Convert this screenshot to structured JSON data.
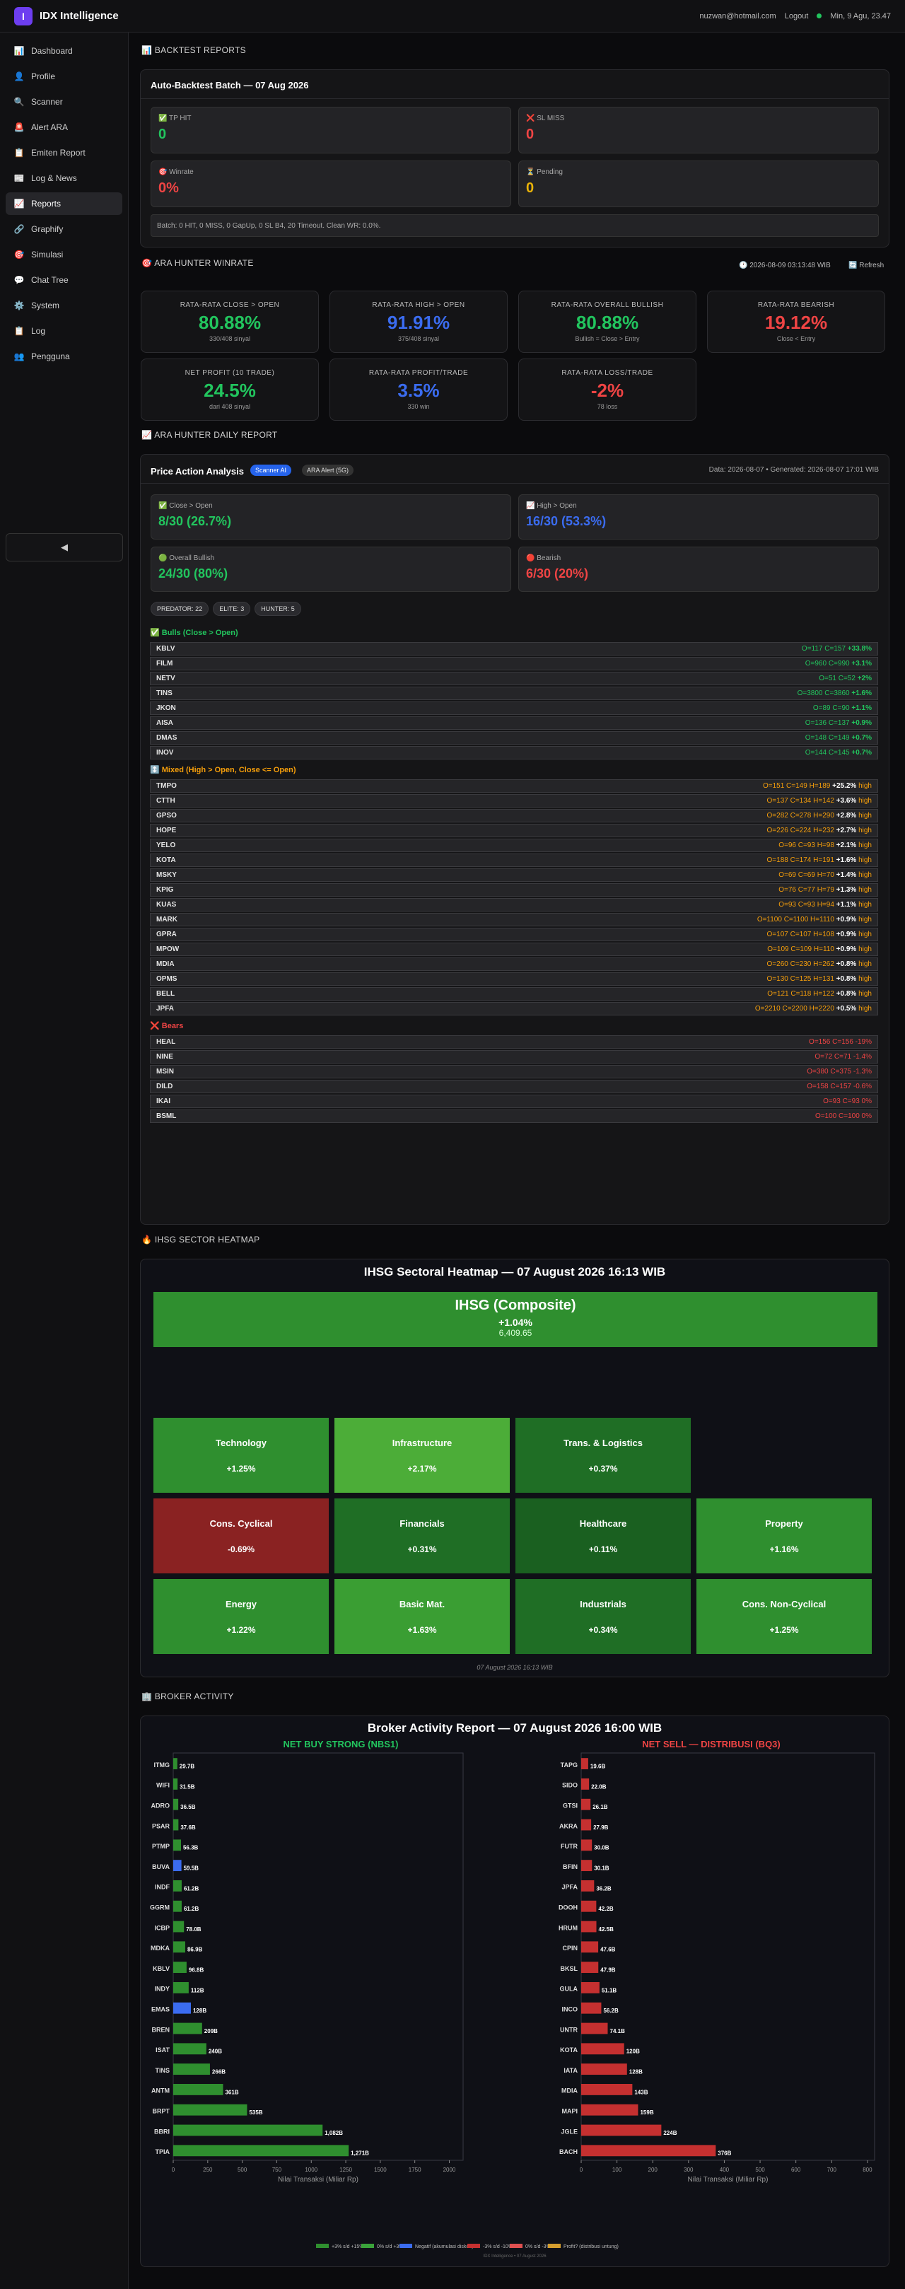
{
  "app": {
    "logo": "I",
    "name": "IDX Intelligence"
  },
  "topbar": {
    "email": "nuzwan@hotmail.com",
    "logout": "Logout",
    "datetime": "Min, 9 Agu, 23.47"
  },
  "sidebar": {
    "items": [
      {
        "icon": "📊",
        "label": "Dashboard"
      },
      {
        "icon": "👤",
        "label": "Profile"
      },
      {
        "icon": "🔍",
        "label": "Scanner"
      },
      {
        "icon": "🚨",
        "label": "Alert ARA"
      },
      {
        "icon": "📋",
        "label": "Emiten Report"
      },
      {
        "icon": "📰",
        "label": "Log & News"
      },
      {
        "icon": "📈",
        "label": "Reports"
      },
      {
        "icon": "🔗",
        "label": "Graphify"
      },
      {
        "icon": "🎯",
        "label": "Simulasi"
      },
      {
        "icon": "💬",
        "label": "Chat Tree"
      },
      {
        "icon": "⚙️",
        "label": "System"
      },
      {
        "icon": "📋",
        "label": "Log"
      },
      {
        "icon": "👥",
        "label": "Pengguna"
      }
    ],
    "collapse": "◀"
  },
  "backtest": {
    "section": "📊 BACKTEST REPORTS",
    "title": "Auto-Backtest Batch — 07 Aug 2026",
    "tp": {
      "label": "✅ TP HIT",
      "value": "0"
    },
    "sl": {
      "label": "❌ SL MISS",
      "value": "0"
    },
    "winrate": {
      "label": "🎯 Winrate",
      "value": "0%"
    },
    "pending": {
      "label": "⏳ Pending",
      "value": "0"
    },
    "note": "Batch: 0 HIT, 0 MISS, 0 GapUp, 0 SL B4, 20 Timeout. Clean WR: 0.0%."
  },
  "winrate": {
    "section": "🎯 ARA HUNTER WINRATE",
    "time": "🕐 2026-08-09 03:13:48 WIB",
    "refresh": "🔄 Refresh",
    "cards": [
      {
        "label": "RATA-RATA CLOSE > OPEN",
        "value": "80.88%",
        "sub": "330/408 sinyal",
        "color": "#22c55e"
      },
      {
        "label": "RATA-RATA HIGH > OPEN",
        "value": "91.91%",
        "sub": "375/408 sinyal",
        "color": "#3b6cf0"
      },
      {
        "label": "RATA-RATA OVERALL BULLISH",
        "value": "80.88%",
        "sub": "Bullish = Close > Entry",
        "color": "#22c55e"
      },
      {
        "label": "RATA-RATA BEARISH",
        "value": "19.12%",
        "sub": "Close < Entry",
        "color": "#ef4444"
      },
      {
        "label": "NET PROFIT (10 TRADE)",
        "value": "24.5%",
        "sub": "dari 408 sinyal",
        "color": "#22c55e"
      },
      {
        "label": "RATA-RATA PROFIT/TRADE",
        "value": "3.5%",
        "sub": "330 win",
        "color": "#3b6cf0"
      },
      {
        "label": "RATA-RATA LOSS/TRADE",
        "value": "-2%",
        "sub": "78 loss",
        "color": "#ef4444"
      }
    ]
  },
  "daily": {
    "section": "📈 ARA HUNTER DAILY REPORT",
    "title": "Price Action Analysis",
    "badge1": "Scanner AI",
    "badge2": "ARA Alert (5G)",
    "meta": "Data: 2026-08-07 • Generated: 2026-08-07 17:01 WIB",
    "s1": {
      "label": "✅ Close > Open",
      "value": "8/30 (26.7%)"
    },
    "s2": {
      "label": "📈 High > Open",
      "value": "16/30 (53.3%)"
    },
    "s3": {
      "label": "🟢 Overall Bullish",
      "value": "24/30 (80%)"
    },
    "s4": {
      "label": "🔴 Bearish",
      "value": "6/30 (20%)"
    },
    "tags": [
      "PREDATOR: 22",
      "ELITE: 3",
      "HUNTER: 5"
    ],
    "bulls_title": "✅ Bulls (Close > Open)",
    "bulls": [
      [
        "KBLV",
        "O=117 C=157 ",
        "+33.8%",
        ""
      ],
      [
        "FILM",
        "O=960 C=990 ",
        "+3.1%",
        ""
      ],
      [
        "NETV",
        "O=51 C=52 ",
        "+2%",
        ""
      ],
      [
        "TINS",
        "O=3800 C=3860 ",
        "+1.6%",
        ""
      ],
      [
        "JKON",
        "O=89 C=90 ",
        "+1.1%",
        ""
      ],
      [
        "AISA",
        "O=136 C=137 ",
        "+0.9%",
        ""
      ],
      [
        "DMAS",
        "O=148 C=149 ",
        "+0.7%",
        ""
      ],
      [
        "INOV",
        "O=144 C=145 ",
        "+0.7%",
        ""
      ]
    ],
    "mixed_title": "↕️ Mixed (High > Open, Close <= Open)",
    "mixed": [
      [
        "TMPO",
        "O=151 C=149 H=189 ",
        "+25.2%",
        " high"
      ],
      [
        "CTTH",
        "O=137 C=134 H=142 ",
        "+3.6%",
        " high"
      ],
      [
        "GPSO",
        "O=282 C=278 H=290 ",
        "+2.8%",
        " high"
      ],
      [
        "HOPE",
        "O=226 C=224 H=232 ",
        "+2.7%",
        " high"
      ],
      [
        "YELO",
        "O=96 C=93 H=98 ",
        "+2.1%",
        " high"
      ],
      [
        "KOTA",
        "O=188 C=174 H=191 ",
        "+1.6%",
        " high"
      ],
      [
        "MSKY",
        "O=69 C=69 H=70 ",
        "+1.4%",
        " high"
      ],
      [
        "KPIG",
        "O=76 C=77 H=79 ",
        "+1.3%",
        " high"
      ],
      [
        "KUAS",
        "O=93 C=93 H=94 ",
        "+1.1%",
        " high"
      ],
      [
        "MARK",
        "O=1100 C=1100 H=1110 ",
        "+0.9%",
        " high"
      ],
      [
        "GPRA",
        "O=107 C=107 H=108 ",
        "+0.9%",
        " high"
      ],
      [
        "MPOW",
        "O=109 C=109 H=110 ",
        "+0.9%",
        " high"
      ],
      [
        "MDIA",
        "O=260 C=230 H=262 ",
        "+0.8%",
        " high"
      ],
      [
        "OPMS",
        "O=130 C=125 H=131 ",
        "+0.8%",
        " high"
      ],
      [
        "BELL",
        "O=121 C=118 H=122 ",
        "+0.8%",
        " high"
      ],
      [
        "JPFA",
        "O=2210 C=2200 H=2220 ",
        "+0.5%",
        " high"
      ]
    ],
    "bears_title": "❌ Bears",
    "bears": [
      [
        "HEAL",
        "O=156 C=156 -19%",
        ""
      ],
      [
        "NINE",
        "O=72 C=71 -1.4%",
        ""
      ],
      [
        "MSIN",
        "O=380 C=375 -1.3%",
        ""
      ],
      [
        "DILD",
        "O=158 C=157 -0.6%",
        ""
      ],
      [
        "IKAI",
        "O=93 C=93 0%",
        ""
      ],
      [
        "BSML",
        "O=100 C=100 0%",
        ""
      ]
    ]
  },
  "heatmap": {
    "section": "🔥 IHSG SECTOR HEATMAP",
    "title": "IHSG Sectoral Heatmap — 07 August 2026 16:13 WIB",
    "ihsg": "IHSG (Composite)",
    "ihsg_chg": "+1.04%",
    "ihsg_val": "6,409.65",
    "footer": "07 August 2026 16:13 WIB",
    "sectors": [
      {
        "name": "Technology",
        "chg": "+1.25%",
        "color": "#2f8f2f"
      },
      {
        "name": "Infrastructure",
        "chg": "+2.17%",
        "color": "#4cad38"
      },
      {
        "name": "Trans. & Logistics",
        "chg": "+0.37%",
        "color": "#1f6e25"
      },
      {
        "name": "Cons. Cyclical",
        "chg": "-0.69%",
        "color": "#8a2222"
      },
      {
        "name": "Financials",
        "chg": "+0.31%",
        "color": "#1f6e25"
      },
      {
        "name": "Healthcare",
        "chg": "+0.11%",
        "color": "#1a6020"
      },
      {
        "name": "Property",
        "chg": "+1.16%",
        "color": "#2f8f2f"
      },
      {
        "name": "Energy",
        "chg": "+1.22%",
        "color": "#2f8f2f"
      },
      {
        "name": "Basic Mat.",
        "chg": "+1.63%",
        "color": "#3a9e33"
      },
      {
        "name": "Industrials",
        "chg": "+0.34%",
        "color": "#1f6e25"
      },
      {
        "name": "Cons. Non-Cyclical",
        "chg": "+1.25%",
        "color": "#2f8f2f"
      }
    ]
  },
  "broker": {
    "section": "🏢 BROKER ACTIVITY",
    "title": "Broker Activity Report — 07 August 2026 16:00 WIB",
    "left_title": "NET BUY STRONG (NBS1)",
    "right_title": "NET SELL — DISTRIBUSI (BQ3)",
    "xlabel": "Nilai Transaksi (Miliar Rp)",
    "legend": [
      "+3% s/d +15%",
      "0% s/d +3%",
      "Negatif (akumulasi diskon)",
      "-3% s/d -10%",
      "0% s/d -3%",
      "Profit? (distribusi untung)"
    ],
    "footnote": "IDX Intelligence • 07 August 2026"
  },
  "chart_data": [
    {
      "type": "bar",
      "orientation": "horizontal",
      "title": "NET BUY STRONG (NBS1)",
      "xlabel": "Nilai Transaksi (Miliar Rp)",
      "xlim": [
        0,
        2100
      ],
      "categories": [
        "ITMG",
        "WIFI",
        "ADRO",
        "PSAR",
        "PTMP",
        "BUVA",
        "INDF",
        "GGRM",
        "ICBP",
        "MDKA",
        "KBLV",
        "INDY",
        "EMAS",
        "BREN",
        "ISAT",
        "TINS",
        "ANTM",
        "BRPT",
        "BBRI",
        "TPIA"
      ],
      "values": [
        29.7,
        31.5,
        36.5,
        37.6,
        56.3,
        59.5,
        61.2,
        61.2,
        78,
        86.9,
        96.8,
        112,
        128,
        209,
        240,
        266,
        361,
        535,
        1082,
        1271
      ],
      "value_labels": [
        "29.7B",
        "31.5B",
        "36.5B",
        "37.6B",
        "56.3B",
        "59.5B",
        "61.2B",
        "61.2B",
        "78.0B",
        "86.9B",
        "96.8B",
        "112B",
        "128B",
        "209B",
        "240B",
        "266B",
        "361B",
        "535B",
        "1,082B",
        "1,271B"
      ]
    },
    {
      "type": "bar",
      "orientation": "horizontal",
      "title": "NET SELL — DISTRIBUSI (BQ3)",
      "xlabel": "Nilai Transaksi (Miliar Rp)",
      "xlim": [
        0,
        820
      ],
      "categories": [
        "TAPG",
        "SIDO",
        "GTSI",
        "AKRA",
        "FUTR",
        "BFIN",
        "JPFA",
        "DOOH",
        "HRUM",
        "CPIN",
        "BKSL",
        "GULA",
        "INCO",
        "UNTR",
        "KOTA",
        "IATA",
        "MDIA",
        "MAPI",
        "JGLE",
        "BACH"
      ],
      "values": [
        19.6,
        22,
        26.1,
        27.9,
        30,
        30.1,
        36.2,
        42.2,
        42.5,
        47.6,
        47.9,
        51.1,
        56.2,
        74.1,
        120,
        128,
        143,
        159,
        224,
        376
      ],
      "value_labels": [
        "19.6B",
        "22.0B",
        "26.1B",
        "27.9B",
        "30.0B",
        "30.1B",
        "36.2B",
        "42.2B",
        "42.5B",
        "47.6B",
        "47.9B",
        "51.1B",
        "56.2B",
        "74.1B",
        "120B",
        "128B",
        "143B",
        "159B",
        "224B",
        "376B"
      ]
    }
  ]
}
